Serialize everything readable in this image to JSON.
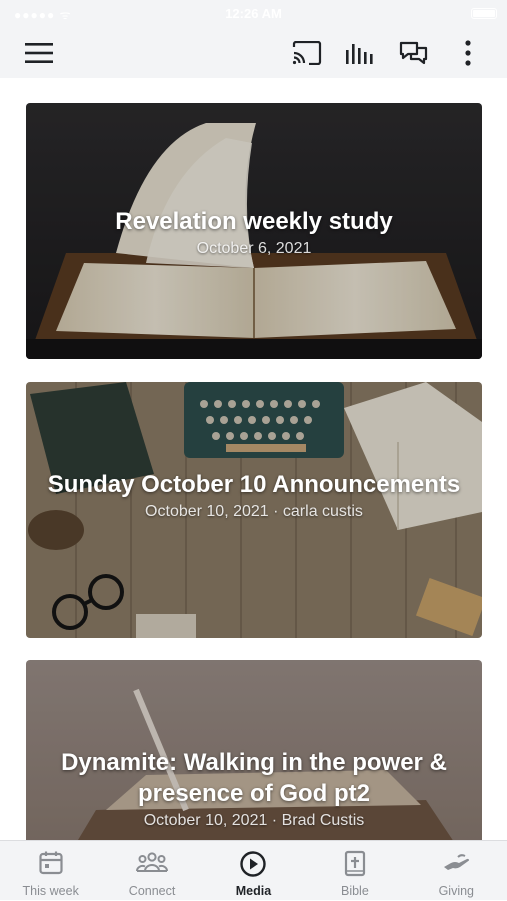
{
  "status_bar": {
    "carrier": "●●●●● ᯤ",
    "time": "12:26 AM"
  },
  "app_bar": {
    "icons": [
      "menu-icon",
      "cast-icon",
      "audio-bars-icon",
      "chat-icon",
      "more-vert-icon"
    ]
  },
  "feed": {
    "cards": [
      {
        "title": "Revelation weekly study",
        "meta": "October 6, 2021"
      },
      {
        "title": "Sunday October 10 Announcements",
        "meta": "October 10, 2021 · carla custis"
      },
      {
        "title": "Dynamite: Walking in the power & presence of God pt2",
        "meta": "October 10, 2021 · Brad Custis"
      }
    ]
  },
  "tab_bar": {
    "tabs": [
      {
        "label": "This week",
        "icon": "calendar-icon"
      },
      {
        "label": "Connect",
        "icon": "people-icon"
      },
      {
        "label": "Media",
        "icon": "play-circle-icon",
        "active": true
      },
      {
        "label": "Bible",
        "icon": "bible-icon"
      },
      {
        "label": "Giving",
        "icon": "giving-hand-icon"
      }
    ],
    "active_color": "#1f2226",
    "inactive_color": "#8a8d92"
  }
}
